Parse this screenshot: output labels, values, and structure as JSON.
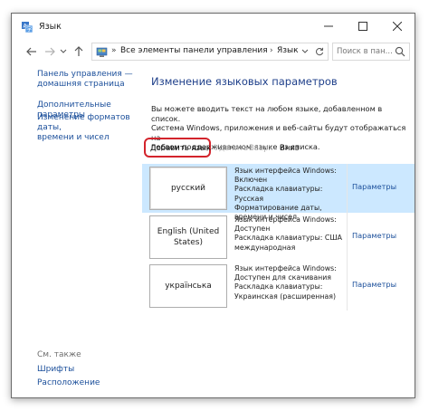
{
  "window": {
    "title": "Язык"
  },
  "address": {
    "crumbs": [
      "Все элементы панели управления",
      "Язык"
    ],
    "separator": "»",
    "arrow": "›"
  },
  "search": {
    "placeholder": "Поиск в пан..."
  },
  "sidebar": {
    "home_link_line1": "Панель управления —",
    "home_link_line2": "домашняя страница",
    "advanced_link": "Дополнительные параметры",
    "date_link_line1": "Изменение форматов даты,",
    "date_link_line2": "времени и чисел",
    "see_also": "См. также",
    "fonts_link": "Шрифты",
    "location_link": "Расположение"
  },
  "main": {
    "title": "Изменение языковых параметров",
    "description_line1": "Вы можете вводить текст на любом языке, добавленном в список.",
    "description_line2": "Система Windows, приложения и веб-сайты будут отображаться на",
    "description_line3": "первом поддерживаемом языке из списка."
  },
  "toolbar": {
    "add": "Добавить язык",
    "delete": "Удалить",
    "up": "Вверх",
    "down": "Вниз"
  },
  "languages": [
    {
      "name_line1": "русский",
      "name_line2": "",
      "info": [
        "Язык интерфейса Windows:",
        "Включен",
        "Раскладка клавиатуры: Русская",
        "Форматирование даты,",
        "времени и чисел"
      ],
      "params": "Параметры"
    },
    {
      "name_line1": "English (United",
      "name_line2": "States)",
      "info": [
        "Язык интерфейса Windows:",
        "Доступен",
        "Раскладка клавиатуры: США",
        "международная",
        ""
      ],
      "params": "Параметры"
    },
    {
      "name_line1": "українська",
      "name_line2": "",
      "info": [
        "Язык интерфейса Windows:",
        "Доступен для скачивания",
        "Раскладка клавиатуры:",
        "Украинская (расширенная)",
        ""
      ],
      "params": "Параметры"
    }
  ],
  "colors": {
    "link": "#1a4e9a",
    "title": "#1e3f8a",
    "selection": "#cce8ff",
    "highlight": "#d3242c"
  }
}
